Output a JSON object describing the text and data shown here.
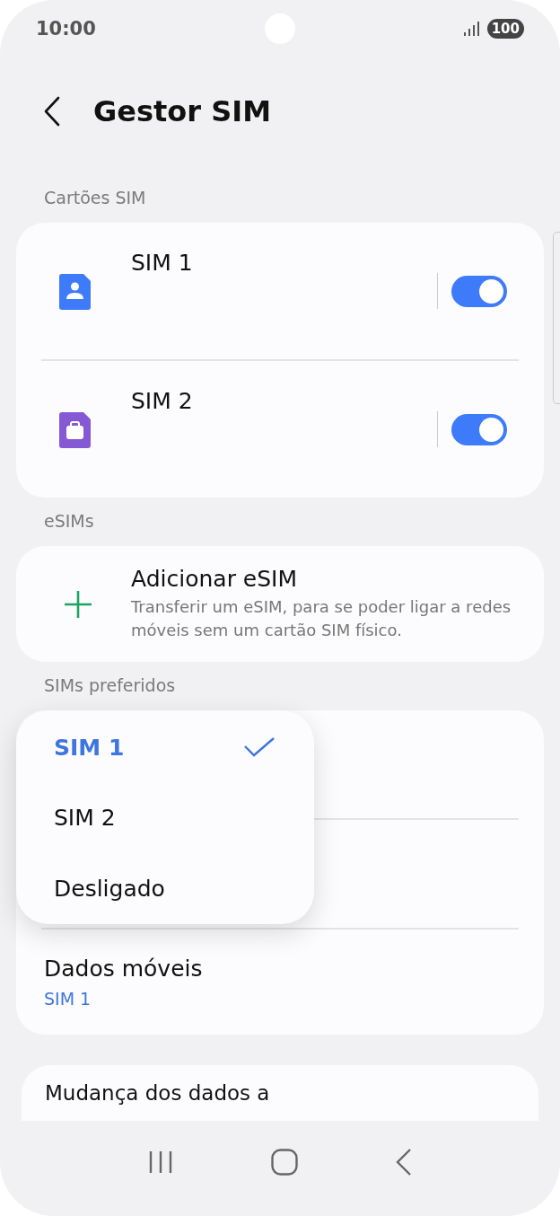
{
  "status_bar": {
    "time": "10:00",
    "battery": "100"
  },
  "header": {
    "title": "Gestor SIM"
  },
  "sim_cards": {
    "label": "Cartões SIM",
    "items": [
      {
        "name": "SIM 1",
        "kind": "person",
        "color": "#3e7bfa",
        "on": true
      },
      {
        "name": "SIM 2",
        "kind": "briefcase",
        "color": "#8659d4",
        "on": true
      }
    ]
  },
  "esims": {
    "label": "eSIMs",
    "add": {
      "title": "Adicionar eSIM",
      "description": "Transferir um eSIM, para se poder ligar a redes móveis sem um cartão SIM físico."
    }
  },
  "preferred": {
    "label": "SIMs preferidos",
    "rows": [
      {
        "title": "Dados móveis",
        "value": "SIM 1"
      }
    ]
  },
  "popup": {
    "options": [
      {
        "label": "SIM 1",
        "selected": true
      },
      {
        "label": "SIM 2",
        "selected": false
      },
      {
        "label": "Desligado",
        "selected": false
      }
    ]
  },
  "next_item": {
    "title": "Mudança dos dados a"
  }
}
